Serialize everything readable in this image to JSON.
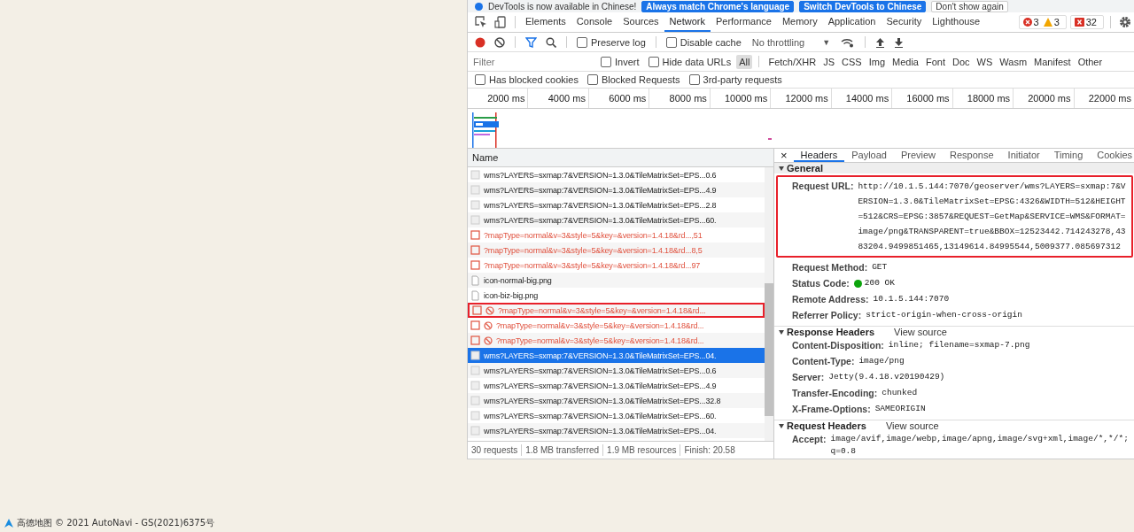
{
  "map": {
    "logo_text": "高德地图",
    "attribution": "© 2021 AutoNavi - GS(2021)6375号"
  },
  "infobar": {
    "message": "DevTools is now available in Chinese!",
    "buttons": [
      {
        "label": "Always match Chrome's language",
        "kind": "primary"
      },
      {
        "label": "Switch DevTools to Chinese",
        "kind": "primary"
      },
      {
        "label": "Don't show again",
        "kind": "plain"
      }
    ]
  },
  "tabs": [
    {
      "label": "Elements",
      "selected": false
    },
    {
      "label": "Console",
      "selected": false
    },
    {
      "label": "Sources",
      "selected": false
    },
    {
      "label": "Network",
      "selected": true
    },
    {
      "label": "Performance",
      "selected": false
    },
    {
      "label": "Memory",
      "selected": false
    },
    {
      "label": "Application",
      "selected": false
    },
    {
      "label": "Security",
      "selected": false
    },
    {
      "label": "Lighthouse",
      "selected": false
    }
  ],
  "counts": {
    "errors": "3",
    "warnings": "3",
    "issues": "32"
  },
  "toolbar": {
    "recording": true,
    "filter_active": true,
    "checkboxes": [
      {
        "label": "Preserve log",
        "checked": false
      },
      {
        "label": "Disable cache",
        "checked": false
      }
    ],
    "throttling": "No throttling",
    "throttling_caret": "▼"
  },
  "filter": {
    "placeholder": "Filter",
    "checkboxes": [
      {
        "label": "Invert",
        "checked": false
      },
      {
        "label": "Hide data URLs",
        "checked": false
      }
    ],
    "types": [
      {
        "label": "All",
        "selected": true
      },
      {
        "label": "Fetch/XHR",
        "selected": false
      },
      {
        "label": "JS",
        "selected": false
      },
      {
        "label": "CSS",
        "selected": false
      },
      {
        "label": "Img",
        "selected": false
      },
      {
        "label": "Media",
        "selected": false
      },
      {
        "label": "Font",
        "selected": false
      },
      {
        "label": "Doc",
        "selected": false
      },
      {
        "label": "WS",
        "selected": false
      },
      {
        "label": "Wasm",
        "selected": false
      },
      {
        "label": "Manifest",
        "selected": false
      },
      {
        "label": "Other",
        "selected": false
      }
    ],
    "more_checkboxes": [
      {
        "label": "Has blocked cookies",
        "checked": false
      },
      {
        "label": "Blocked Requests",
        "checked": false
      },
      {
        "label": "3rd-party requests",
        "checked": false
      }
    ]
  },
  "timeline": {
    "ticks": [
      "2000 ms",
      "4000 ms",
      "6000 ms",
      "8000 ms",
      "10000 ms",
      "12000 ms",
      "14000 ms",
      "16000 ms",
      "18000 ms",
      "20000 ms",
      "22000 ms"
    ]
  },
  "requests": {
    "column": "Name",
    "rows": [
      {
        "kind": "image",
        "name": "wms?LAYERS=sxmap:7&VERSION=1.3.0&TileMatrixSet=EPS...0.6",
        "selected": false,
        "outlined": false
      },
      {
        "kind": "image",
        "name": "wms?LAYERS=sxmap:7&VERSION=1.3.0&TileMatrixSet=EPS...4.9",
        "selected": false,
        "outlined": false
      },
      {
        "kind": "image",
        "name": "wms?LAYERS=sxmap:7&VERSION=1.3.0&TileMatrixSet=EPS...2.8",
        "selected": false,
        "outlined": false
      },
      {
        "kind": "image",
        "name": "wms?LAYERS=sxmap:7&VERSION=1.3.0&TileMatrixSet=EPS...60.",
        "selected": false,
        "outlined": false
      },
      {
        "kind": "failed",
        "name": "?mapType=normal&v=3&style=5&key=&version=1.4.18&rd...,51",
        "selected": false,
        "outlined": false
      },
      {
        "kind": "failed",
        "name": "?mapType=normal&v=3&style=5&key=&version=1.4.18&rd...8,5",
        "selected": false,
        "outlined": false
      },
      {
        "kind": "failed",
        "name": "?mapType=normal&v=3&style=5&key=&version=1.4.18&rd...97",
        "selected": false,
        "outlined": false
      },
      {
        "kind": "file",
        "name": "icon-normal-big.png",
        "selected": false,
        "outlined": false
      },
      {
        "kind": "file",
        "name": "icon-biz-big.png",
        "selected": false,
        "outlined": false
      },
      {
        "kind": "blocked",
        "name": "?mapType=normal&v=3&style=5&key=&version=1.4.18&rd...",
        "selected": false,
        "outlined": true
      },
      {
        "kind": "blocked",
        "name": "?mapType=normal&v=3&style=5&key=&version=1.4.18&rd...",
        "selected": false,
        "outlined": false
      },
      {
        "kind": "blocked",
        "name": "?mapType=normal&v=3&style=5&key=&version=1.4.18&rd...",
        "selected": false,
        "outlined": false
      },
      {
        "kind": "image",
        "name": "wms?LAYERS=sxmap:7&VERSION=1.3.0&TileMatrixSet=EPS...04.",
        "selected": true,
        "outlined": false
      },
      {
        "kind": "image",
        "name": "wms?LAYERS=sxmap:7&VERSION=1.3.0&TileMatrixSet=EPS...0.6",
        "selected": false,
        "outlined": false
      },
      {
        "kind": "image",
        "name": "wms?LAYERS=sxmap:7&VERSION=1.3.0&TileMatrixSet=EPS...4.9",
        "selected": false,
        "outlined": false
      },
      {
        "kind": "image",
        "name": "wms?LAYERS=sxmap:7&VERSION=1.3.0&TileMatrixSet=EPS...32.8",
        "selected": false,
        "outlined": false
      },
      {
        "kind": "image",
        "name": "wms?LAYERS=sxmap:7&VERSION=1.3.0&TileMatrixSet=EPS...60.",
        "selected": false,
        "outlined": false
      },
      {
        "kind": "image",
        "name": "wms?LAYERS=sxmap:7&VERSION=1.3.0&TileMatrixSet=EPS...04.",
        "selected": false,
        "outlined": false
      }
    ]
  },
  "status_bar": [
    "30 requests",
    "1.8 MB transferred",
    "1.9 MB resources",
    "Finish: 20.58"
  ],
  "details": {
    "close": "×",
    "tabs": [
      {
        "label": "Headers",
        "selected": true
      },
      {
        "label": "Payload",
        "selected": false
      },
      {
        "label": "Preview",
        "selected": false
      },
      {
        "label": "Response",
        "selected": false
      },
      {
        "label": "Initiator",
        "selected": false
      },
      {
        "label": "Timing",
        "selected": false
      },
      {
        "label": "Cookies",
        "selected": false
      }
    ],
    "sections": [
      {
        "title": "General",
        "expanded": true,
        "rows": [
          {
            "name": "Request URL:",
            "value": "http://10.1.5.144:7070/geoserver/wms?LAYERS=sxmap:7&VERSION=1.3.0&TileMatrixSet=EPSG:4326&WIDTH=512&HEIGHT=512&CRS=EPSG:3857&REQUEST=GetMap&SERVICE=WMS&FORMAT=image/png&TRANSPARENT=true&BBOX=12523442.714243278,4383204.9499851465,13149614.84995544,5009377.085697312",
            "outlined": true
          },
          {
            "name": "Request Method:",
            "value": "GET",
            "outlined": false
          },
          {
            "name": "Status Code:",
            "value": "200 OK",
            "color": "#0ca40c",
            "outlined": false
          },
          {
            "name": "Remote Address:",
            "value": "10.1.5.144:7070",
            "outlined": false
          },
          {
            "name": "Referrer Policy:",
            "value": "strict-origin-when-cross-origin",
            "outlined": false
          }
        ]
      },
      {
        "title": "Response Headers",
        "expanded": true,
        "view_source": "View source",
        "rows": [
          {
            "name": "Content-Disposition:",
            "value": "inline; filename=sxmap-7.png",
            "outlined": false
          },
          {
            "name": "Content-Type:",
            "value": "image/png",
            "outlined": false
          },
          {
            "name": "Server:",
            "value": "Jetty(9.4.18.v20190429)",
            "outlined": false
          },
          {
            "name": "Transfer-Encoding:",
            "value": "chunked",
            "outlined": false
          },
          {
            "name": "X-Frame-Options:",
            "value": "SAMEORIGIN",
            "outlined": false
          }
        ]
      },
      {
        "title": "Request Headers",
        "expanded": true,
        "view_source": "View source",
        "rows": [
          {
            "name": "Accept:",
            "value": "image/avif,image/webp,image/apng,image/svg+xml,image/*,*/*;q=0.8",
            "outlined": false
          }
        ]
      }
    ]
  }
}
